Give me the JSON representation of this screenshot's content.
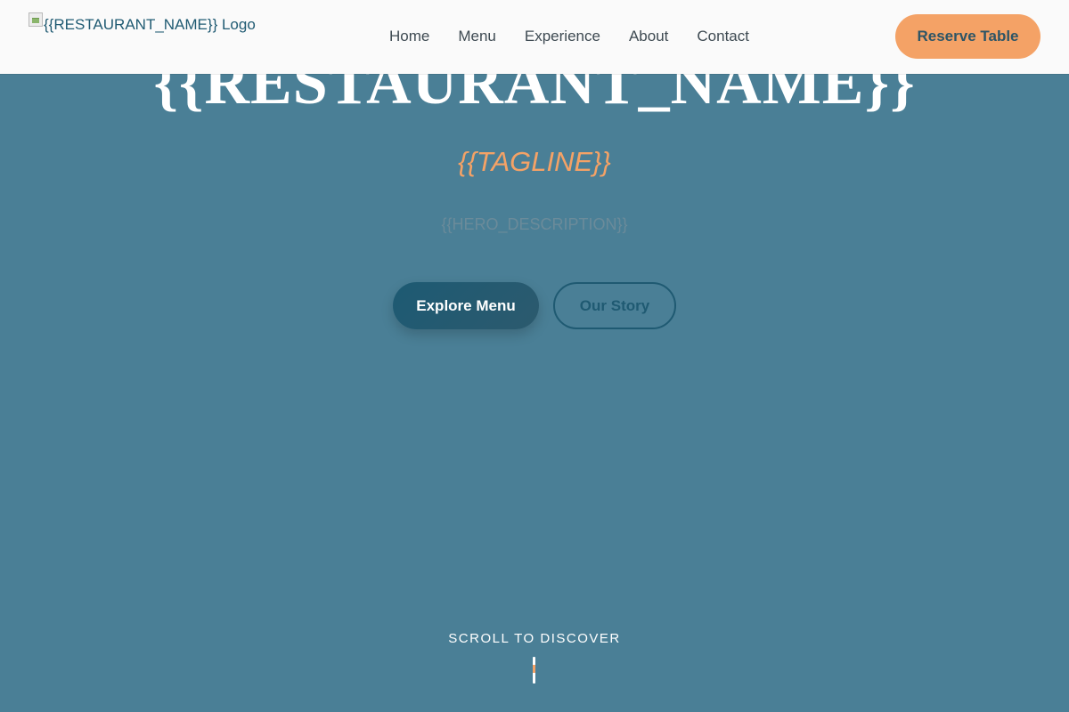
{
  "header": {
    "logo_alt": "{{RESTAURANT_NAME}} Logo",
    "nav": [
      "Home",
      "Menu",
      "Experience",
      "About",
      "Contact"
    ],
    "reserve_label": "Reserve Table"
  },
  "hero": {
    "title": "{{RESTAURANT_NAME}}",
    "tagline": "{{TAGLINE}}",
    "description": "{{HERO_DESCRIPTION}}",
    "primary_cta": "Explore Menu",
    "secondary_cta": "Our Story"
  },
  "scroll": {
    "label": "SCROLL TO DISCOVER"
  },
  "colors": {
    "accent": "#f4a266",
    "primary": "#1f5a72",
    "hero_background": "#4a7f96"
  }
}
